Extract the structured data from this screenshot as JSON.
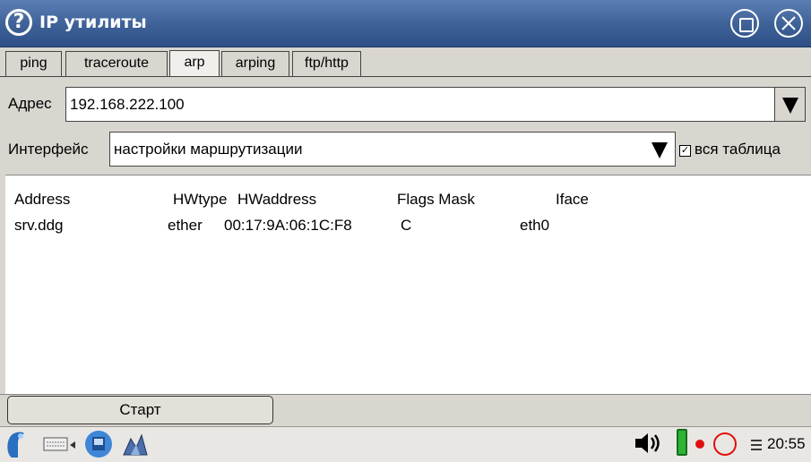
{
  "window": {
    "title": "IP утилиты"
  },
  "tabs": [
    {
      "label": "ping"
    },
    {
      "label": "traceroute"
    },
    {
      "label": "arp",
      "active": true
    },
    {
      "label": "arping"
    },
    {
      "label": "ftp/http"
    }
  ],
  "address": {
    "label": "Адрес",
    "value": "192.168.222.100"
  },
  "interface": {
    "label": "Интерфейс",
    "value": "настройки маршрутизации",
    "checkbox_label": "вся таблица",
    "checked": true
  },
  "results": {
    "headers": [
      "Address",
      "HWtype",
      "HWaddress",
      "Flags Mask",
      "Iface"
    ],
    "rows": [
      [
        "srv.ddg",
        "ether",
        "00:17:9A:06:1C:F8",
        "C",
        "eth0"
      ]
    ]
  },
  "actions": {
    "start_label": "Старт"
  },
  "taskbar": {
    "clock": "20:55"
  },
  "colors": {
    "titlebar": "#3d6197",
    "battery": "#2bb533",
    "record": "#e01010"
  }
}
